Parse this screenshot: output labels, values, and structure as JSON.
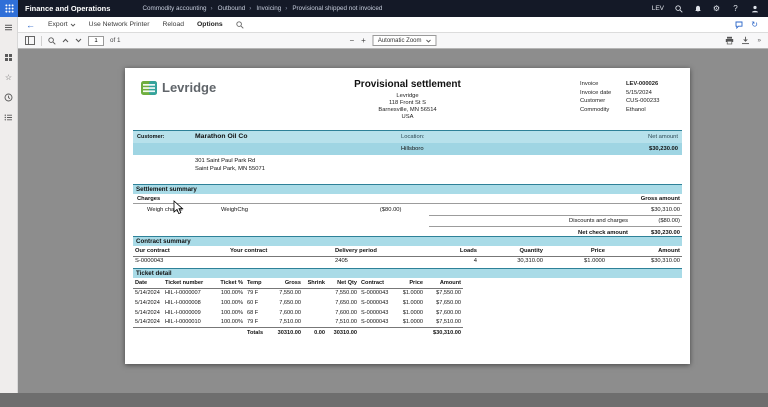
{
  "topbar": {
    "app_title": "Finance and Operations",
    "breadcrumb": [
      "Commodity accounting",
      "Outbound",
      "Invoicing",
      "Provisional shipped not invoiced"
    ],
    "environment": "LEV"
  },
  "actionbar": {
    "back": "←",
    "export": "Export",
    "use_network_printer": "Use Network Printer",
    "reload": "Reload",
    "options": "Options"
  },
  "pdf_toolbar": {
    "page_value": "1",
    "page_total": "of 1",
    "zoom_out": "−",
    "zoom_in": "+",
    "zoom_select": "Automatic Zoom"
  },
  "doc": {
    "logo_text": "Levridge",
    "title": "Provisional settlement",
    "company_lines": [
      "Levridge",
      "118 Front St S",
      "Barnesville, MN 56514",
      "USA"
    ],
    "meta": {
      "invoice_label": "Invoice",
      "invoice_value": "LEV-000026",
      "invoice_date_label": "Invoice date",
      "invoice_date_value": "5/15/2024",
      "customer_label": "Customer",
      "customer_value": "CUS-000233",
      "commodity_label": "Commodity",
      "commodity_value": "Ethanol"
    },
    "customer_band": {
      "customer_label": "Customer:",
      "customer_name": "Marathon Oil Co",
      "location_label": "Location:",
      "location_value": "Hillsboro",
      "net_amount_label": "Net amount",
      "net_amount_value": "$30,230.00",
      "address_line1": "301 Saint Paul Park Rd",
      "address_line2": "Saint Paul Park, MN 55071"
    },
    "settlement": {
      "title": "Settlement summary",
      "charges_header": "Charges",
      "gross_header": "Gross amount",
      "charge_name": "Weigh charge",
      "charge_code": "WeighChg",
      "charge_amount": "($80.00)",
      "gross_value": "$30,310.00",
      "discounts_label": "Discounts and charges",
      "discounts_value": "($80.00)",
      "net_label": "Net check amount",
      "net_value": "$30,230.00"
    },
    "contract": {
      "title": "Contract summary",
      "headers": [
        "Our contract",
        "Your contract",
        "Delivery period",
        "Loads",
        "Quantity",
        "Price",
        "Amount"
      ],
      "row": [
        "S-0000043",
        "",
        "2405",
        "4",
        "30,310.00",
        "$1.0000",
        "$30,310.00"
      ]
    },
    "tickets": {
      "title": "Ticket detail",
      "headers": [
        "Date",
        "Ticket number",
        "Ticket %",
        "Temp",
        "Gross",
        "Shrink",
        "Net Qty",
        "Contract",
        "Price",
        "Amount"
      ],
      "rows": [
        [
          "5/14/2024",
          "HIL-I-0000007",
          "100.00%",
          "79 F",
          "7,550.00",
          "",
          "7,550.00",
          "S-0000043",
          "$1.0000",
          "$7,550.00"
        ],
        [
          "5/14/2024",
          "HIL-I-0000008",
          "100.00%",
          "60 F",
          "7,650.00",
          "",
          "7,650.00",
          "S-0000043",
          "$1.0000",
          "$7,650.00"
        ],
        [
          "5/14/2024",
          "HIL-I-0000009",
          "100.00%",
          "68 F",
          "7,600.00",
          "",
          "7,600.00",
          "S-0000043",
          "$1.0000",
          "$7,600.00"
        ],
        [
          "5/14/2024",
          "HIL-I-0000010",
          "100.00%",
          "79 F",
          "7,510.00",
          "",
          "7,510.00",
          "S-0000043",
          "$1.0000",
          "$7,510.00"
        ]
      ],
      "totals_label": "Totals",
      "totals_gross": "30310.00",
      "totals_shrink": "0.00",
      "totals_netqty": "30310.00",
      "totals_amount": "$30,310.00"
    }
  }
}
